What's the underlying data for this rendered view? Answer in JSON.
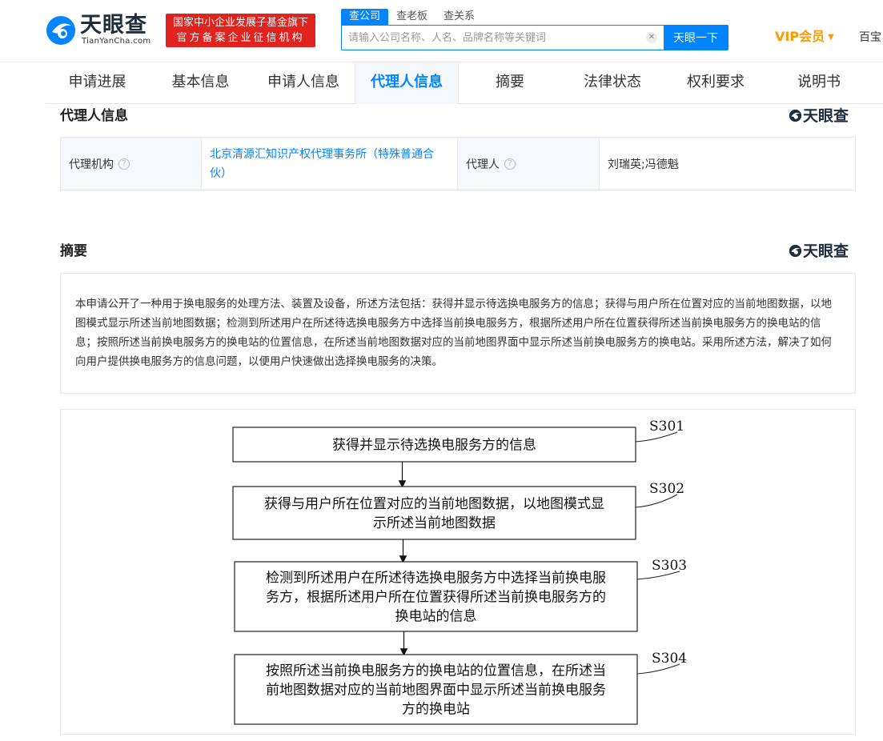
{
  "header": {
    "logo_text": "天眼查",
    "logo_sub": "TianYanCha.com",
    "banner_line1": "国家中小企业发展子基金旗下",
    "banner_line2": "官方备案企业征信机构",
    "search_tabs": [
      "查公司",
      "查老板",
      "查关系"
    ],
    "search_placeholder": "请输入公司名称、人名、品牌名称等关键词",
    "search_button": "天眼一下",
    "vip_label": "VIP会员",
    "more_text": "百宝"
  },
  "nav": {
    "tabs": [
      "申请进展",
      "基本信息",
      "申请人信息",
      "代理人信息",
      "摘要",
      "法律状态",
      "权利要求",
      "说明书"
    ],
    "active_index": 3
  },
  "agent_section": {
    "title": "代理人信息",
    "brand": "天眼查",
    "agency_label": "代理机构",
    "agency_value": "北京清源汇知识产权代理事务所（特殊普通合伙）",
    "agent_label": "代理人",
    "agent_value": "刘瑞英;冯德魁"
  },
  "abstract_section": {
    "title": "摘要",
    "brand": "天眼查",
    "text": "本申请公开了一种用于换电服务的处理方法、装置及设备，所述方法包括：获得并显示待选换电服务方的信息；获得与用户所在位置对应的当前地图数据，以地图模式显示所述当前地图数据；检测到所述用户在所述待选换电服务方中选择当前换电服务方，根据所述用户所在位置获得所述当前换电服务方的换电站的信息；按照所述当前换电服务方的换电站的位置信息，在所述当前地图数据对应的当前地图界面中显示所述当前换电服务方的换电站。采用所述方法，解决了如何向用户提供换电服务方的信息问题，以便用户快速做出选择换电服务的决策。"
  },
  "figure": {
    "steps": [
      {
        "label": "S301",
        "lines": [
          "获得并显示待选换电服务方的信息"
        ]
      },
      {
        "label": "S302",
        "lines": [
          "获得与用户所在位置对应的当前地图数据，以地图模式显",
          "示所述当前地图数据"
        ]
      },
      {
        "label": "S303",
        "lines": [
          "检测到所述用户在所述待选换电服务方中选择当前换电服",
          "务方，根据所述用户所在位置获得所述当前换电服务方的",
          "换电站的信息"
        ]
      },
      {
        "label": "S304",
        "lines": [
          "按照所述当前换电服务方的换电站的位置信息，在所述当",
          "前地图数据对应的当前地图界面中显示所述当前换电服务",
          "方的换电站"
        ]
      }
    ]
  },
  "colors": {
    "accent": "#0084ff",
    "banner": "#e0231e",
    "vip": "#ff9a00"
  }
}
